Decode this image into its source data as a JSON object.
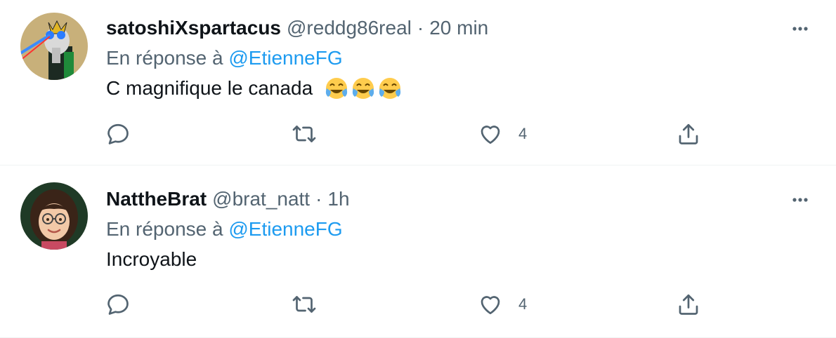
{
  "tweets": [
    {
      "name": "satoshiXspartacus",
      "handle": "@reddg86real",
      "separator": "·",
      "time": "20 min",
      "reply_prefix": "En réponse à",
      "reply_to": "@EtienneFG",
      "text": "C magnifique le canada",
      "emojis": [
        "face-with-tears-of-joy-emoji",
        "face-with-tears-of-joy-emoji",
        "face-with-tears-of-joy-emoji"
      ],
      "like_count": "4",
      "icons": {
        "reply": "reply-icon",
        "retweet": "retweet-icon",
        "like": "heart-icon",
        "share": "share-icon",
        "more": "more-icon"
      }
    },
    {
      "name": "NattheBrat",
      "handle": "@brat_natt",
      "separator": "·",
      "time": "1h",
      "reply_prefix": "En réponse à",
      "reply_to": "@EtienneFG",
      "text": "Incroyable",
      "like_count": "4",
      "icons": {
        "reply": "reply-icon",
        "retweet": "retweet-icon",
        "like": "heart-icon",
        "share": "share-icon",
        "more": "more-icon"
      }
    }
  ],
  "colors": {
    "accent": "#1d9bf0",
    "secondary_text": "#536471",
    "divider": "#eff3f4"
  }
}
